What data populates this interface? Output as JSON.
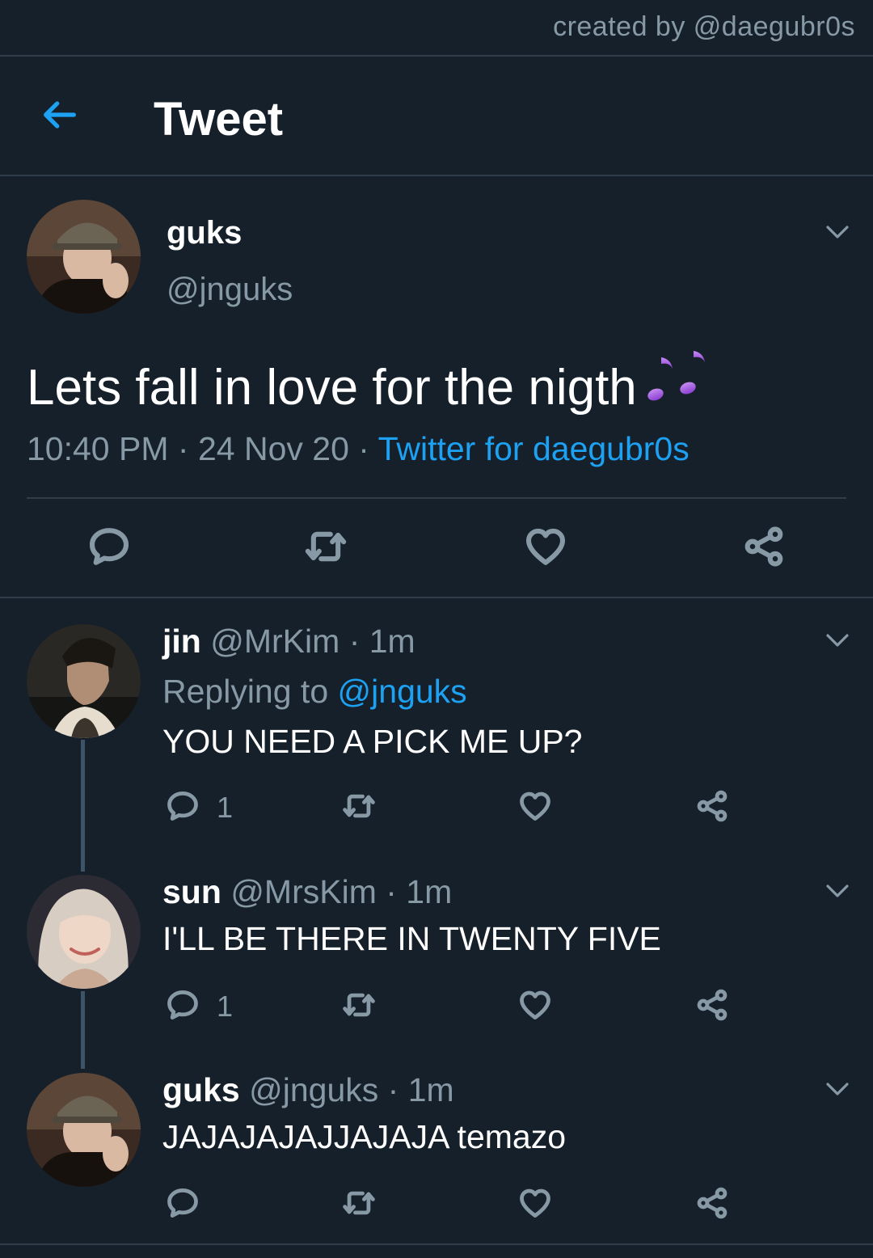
{
  "credit": "created by @daegubr0s",
  "header": {
    "title": "Tweet",
    "back_icon": "arrow-left-icon"
  },
  "colors": {
    "background": "#15202b",
    "accent": "#1da1f2",
    "muted": "#8899a6",
    "divider": "#2f3d4b"
  },
  "tweet": {
    "name": "guks",
    "handle": "@jnguks",
    "text": "Lets fall in love for the nigth",
    "emoji": "musical-notes-icon",
    "time": "10:40 PM",
    "date": "24 Nov 20",
    "sep": "·",
    "source": "Twitter for daegubr0s"
  },
  "replies": [
    {
      "name": "jin",
      "handle": "@MrKim",
      "time": "· 1m",
      "replying_label": "Replying to",
      "replying_handle": "@jnguks",
      "text": "YOU NEED A PICK ME UP?",
      "reply_count": "1"
    },
    {
      "name": "sun",
      "handle": "@MrsKim",
      "time": "· 1m",
      "text": "I'LL BE THERE IN TWENTY FIVE",
      "reply_count": "1"
    },
    {
      "name": "guks",
      "handle": "@jnguks",
      "time": "· 1m",
      "text": "JAJAJAJAJJAJAJA temazo",
      "reply_count": ""
    }
  ]
}
